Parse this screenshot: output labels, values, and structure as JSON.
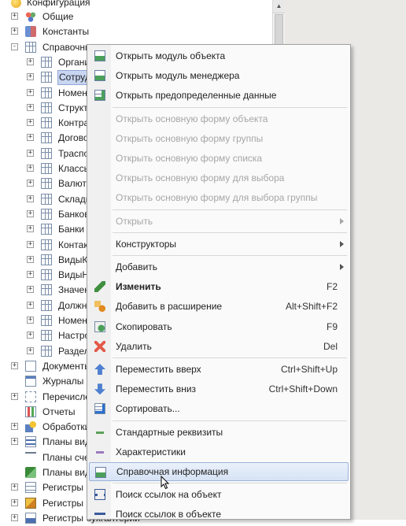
{
  "tree": {
    "root": "Конфигурация",
    "items": [
      {
        "label": "Общие",
        "indent": 0,
        "exp": "+",
        "icon": "common-icon"
      },
      {
        "label": "Константы",
        "indent": 0,
        "exp": "+",
        "icon": "constants-icon"
      },
      {
        "label": "Справочники",
        "indent": 0,
        "exp": "−",
        "icon": "catalogs-icon"
      },
      {
        "label": "Организации",
        "indent": 1,
        "exp": "+",
        "icon": "table-icon"
      },
      {
        "label": "Сотрудники",
        "indent": 1,
        "exp": "+",
        "icon": "table-icon",
        "selected": true
      },
      {
        "label": "Номенклатура",
        "indent": 1,
        "exp": "+",
        "icon": "table-icon"
      },
      {
        "label": "Структура",
        "indent": 1,
        "exp": "+",
        "icon": "table-icon"
      },
      {
        "label": "Контрагенты",
        "indent": 1,
        "exp": "+",
        "icon": "table-icon"
      },
      {
        "label": "Договоры",
        "indent": 1,
        "exp": "+",
        "icon": "table-icon"
      },
      {
        "label": "Траспорт",
        "indent": 1,
        "exp": "+",
        "icon": "table-icon"
      },
      {
        "label": "Классы",
        "indent": 1,
        "exp": "+",
        "icon": "table-icon"
      },
      {
        "label": "Валюты",
        "indent": 1,
        "exp": "+",
        "icon": "table-icon"
      },
      {
        "label": "Склады",
        "indent": 1,
        "exp": "+",
        "icon": "table-icon"
      },
      {
        "label": "Банковские",
        "indent": 1,
        "exp": "+",
        "icon": "table-icon"
      },
      {
        "label": "Банки",
        "indent": 1,
        "exp": "+",
        "icon": "table-icon"
      },
      {
        "label": "Контакты",
        "indent": 1,
        "exp": "+",
        "icon": "table-icon"
      },
      {
        "label": "ВидыКонтактов",
        "indent": 1,
        "exp": "+",
        "icon": "table-icon"
      },
      {
        "label": "ВидыНоменклатуры",
        "indent": 1,
        "exp": "+",
        "icon": "table-icon"
      },
      {
        "label": "Значения",
        "indent": 1,
        "exp": "+",
        "icon": "table-icon"
      },
      {
        "label": "Должности",
        "indent": 1,
        "exp": "+",
        "icon": "table-icon"
      },
      {
        "label": "Номенклатурные",
        "indent": 1,
        "exp": "+",
        "icon": "table-icon"
      },
      {
        "label": "Настройки",
        "indent": 1,
        "exp": "+",
        "icon": "table-icon"
      },
      {
        "label": "Разделы",
        "indent": 1,
        "exp": "+",
        "icon": "table-icon"
      },
      {
        "label": "Документы",
        "indent": 0,
        "exp": "+",
        "icon": "documents-icon"
      },
      {
        "label": "Журналы",
        "indent": 0,
        "exp": "",
        "icon": "journals-icon"
      },
      {
        "label": "Перечисления",
        "indent": 0,
        "exp": "+",
        "icon": "enums-icon"
      },
      {
        "label": "Отчеты",
        "indent": 0,
        "exp": "",
        "icon": "reports-icon"
      },
      {
        "label": "Обработки",
        "indent": 0,
        "exp": "+",
        "icon": "processing-icon"
      },
      {
        "label": "Планы видов характеристик",
        "indent": 0,
        "exp": "+",
        "icon": "chart-types-icon"
      },
      {
        "label": "Планы счетов",
        "indent": 0,
        "exp": "",
        "icon": "accounts-icon"
      },
      {
        "label": "Планы видов расчета",
        "indent": 0,
        "exp": "",
        "icon": "calc-types-icon"
      },
      {
        "label": "Регистры сведений",
        "indent": 0,
        "exp": "+",
        "icon": "info-registers-icon"
      },
      {
        "label": "Регистры накопления",
        "indent": 0,
        "exp": "+",
        "icon": "accum-registers-icon"
      },
      {
        "label": "Регистры бухгалтерии",
        "indent": 0,
        "exp": "+",
        "icon": "acc-registers-icon"
      }
    ]
  },
  "menu": {
    "items": [
      {
        "type": "item",
        "label": "Открыть модуль объекта",
        "icon": "module-icon"
      },
      {
        "type": "item",
        "label": "Открыть модуль менеджера",
        "icon": "module-icon"
      },
      {
        "type": "item",
        "label": "Открыть предопределенные данные",
        "icon": "predefined-icon"
      },
      {
        "type": "sep"
      },
      {
        "type": "item",
        "label": "Открыть основную форму объекта",
        "disabled": true
      },
      {
        "type": "item",
        "label": "Открыть основную форму группы",
        "disabled": true
      },
      {
        "type": "item",
        "label": "Открыть основную форму списка",
        "disabled": true
      },
      {
        "type": "item",
        "label": "Открыть основную форму для выбора",
        "disabled": true
      },
      {
        "type": "item",
        "label": "Открыть основную форму для выбора группы",
        "disabled": true
      },
      {
        "type": "sep"
      },
      {
        "type": "item",
        "label": "Открыть",
        "disabled": true,
        "submenu": true
      },
      {
        "type": "sep"
      },
      {
        "type": "item",
        "label": "Конструкторы",
        "submenu": true
      },
      {
        "type": "sep"
      },
      {
        "type": "item",
        "label": "Добавить",
        "submenu": true
      },
      {
        "type": "item",
        "label": "Изменить",
        "shortcut": "F2",
        "icon": "pencil-icon",
        "bold": true
      },
      {
        "type": "item",
        "label": "Добавить в расширение",
        "shortcut": "Alt+Shift+F2",
        "icon": "add-extension-icon"
      },
      {
        "type": "item",
        "label": "Скопировать",
        "shortcut": "F9",
        "icon": "copy-icon"
      },
      {
        "type": "item",
        "label": "Удалить",
        "shortcut": "Del",
        "icon": "delete-icon"
      },
      {
        "type": "sep"
      },
      {
        "type": "item",
        "label": "Переместить вверх",
        "shortcut": "Ctrl+Shift+Up",
        "icon": "arrow-up-icon"
      },
      {
        "type": "item",
        "label": "Переместить вниз",
        "shortcut": "Ctrl+Shift+Down",
        "icon": "arrow-down-icon"
      },
      {
        "type": "item",
        "label": "Сортировать...",
        "icon": "sort-icon"
      },
      {
        "type": "sep"
      },
      {
        "type": "item",
        "label": "Стандартные реквизиты",
        "icon": "std-attrs-icon"
      },
      {
        "type": "item",
        "label": "Характеристики",
        "icon": "characteristics-icon"
      },
      {
        "type": "item",
        "label": "Справочная информация",
        "icon": "help-info-icon",
        "highlighted": true
      },
      {
        "type": "sep"
      },
      {
        "type": "item",
        "label": "Поиск ссылок на объект",
        "icon": "find-refs-icon"
      },
      {
        "type": "item",
        "label": "Поиск ссылок в объекте",
        "icon": "find-refs-in-icon"
      }
    ]
  }
}
